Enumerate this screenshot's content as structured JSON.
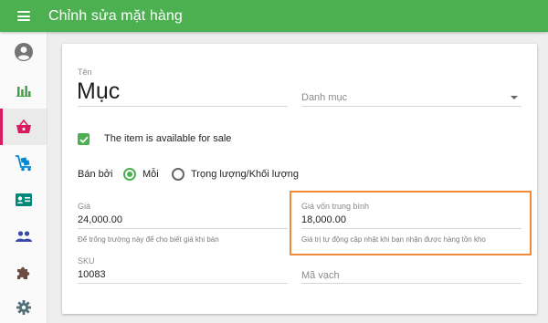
{
  "header": {
    "title": "Chỉnh sửa mặt hàng",
    "menu_icon": "menu-icon",
    "color": "#4caf50"
  },
  "sidebar": {
    "items": [
      {
        "icon": "account-circle-icon",
        "color": "#757575",
        "active": false
      },
      {
        "icon": "bar-chart-icon",
        "color": "#43a047",
        "active": false
      },
      {
        "icon": "shopping-basket-icon",
        "color": "#d81b60",
        "active": true
      },
      {
        "icon": "delivery-cart-icon",
        "color": "#0288d1",
        "active": false
      },
      {
        "icon": "contact-card-icon",
        "color": "#00897b",
        "active": false
      },
      {
        "icon": "people-icon",
        "color": "#3949ab",
        "active": false
      },
      {
        "icon": "puzzle-icon",
        "color": "#6d4c41",
        "active": false
      },
      {
        "icon": "settings-icon",
        "color": "#546e7a",
        "active": false
      }
    ]
  },
  "form": {
    "name": {
      "label": "Tên",
      "value": "Mục"
    },
    "category": {
      "placeholder": "Danh mục"
    },
    "available": {
      "label": "The item is available for sale",
      "checked": true
    },
    "sold_by": {
      "label": "Bán bởi",
      "options": [
        {
          "label": "Mỗi",
          "checked": true
        },
        {
          "label": "Trọng lượng/Khối lượng",
          "checked": false
        }
      ]
    },
    "price": {
      "label": "Giá",
      "value": "24,000.00",
      "hint": "Để trống trường này để cho biết giá khi bán"
    },
    "avg_cost": {
      "label": "Giá vốn trung bình",
      "value": "18,000.00",
      "hint": "Giá trị tự động cập nhật khi bạn nhận được hàng tồn kho"
    },
    "sku": {
      "label": "SKU",
      "value": "10083"
    },
    "barcode": {
      "placeholder": "Mã vạch"
    }
  },
  "colors": {
    "accent": "#4caf50",
    "active_nav": "#d81b60",
    "highlight": "#f08a38"
  }
}
